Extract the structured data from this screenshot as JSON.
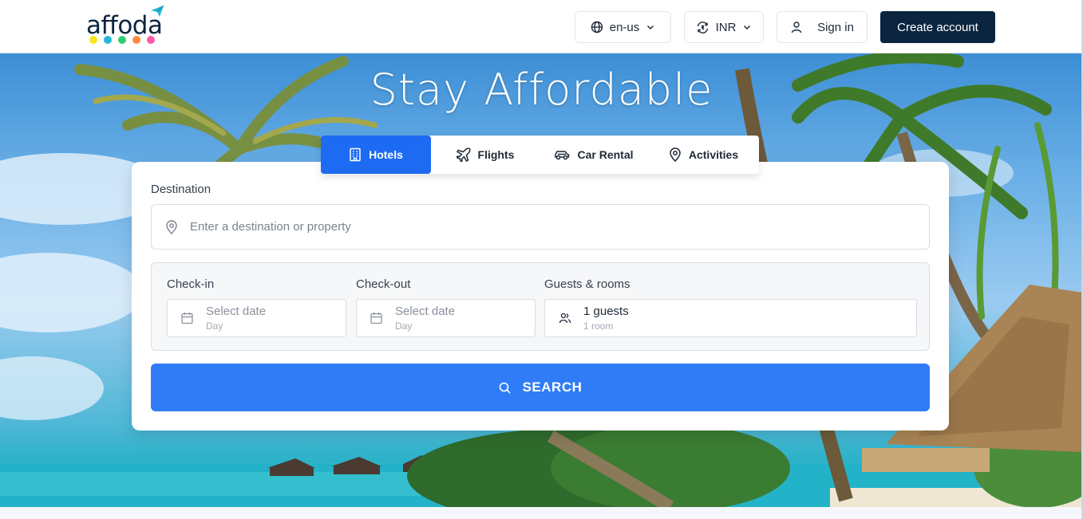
{
  "header": {
    "logo_text": "affoda",
    "logo_dot_colors": [
      "#f8e71c",
      "#22b8d6",
      "#2ecc71",
      "#ff8a3d",
      "#ff5aa5"
    ],
    "language_label": "en-us",
    "currency_label": "INR",
    "signin_label": "Sign in",
    "create_account_label": "Create account"
  },
  "hero": {
    "title": "Stay Affordable"
  },
  "tabs": [
    {
      "label": "Hotels",
      "icon": "building-icon",
      "active": true
    },
    {
      "label": "Flights",
      "icon": "airplane-icon",
      "active": false
    },
    {
      "label": "Car Rental",
      "icon": "car-icon",
      "active": false
    },
    {
      "label": "Activities",
      "icon": "location-pin-icon",
      "active": false
    }
  ],
  "search": {
    "destination_label": "Destination",
    "destination_placeholder": "Enter a destination or property",
    "checkin_label": "Check-in",
    "checkin_value": "Select date",
    "checkin_sub": "Day",
    "checkout_label": "Check-out",
    "checkout_value": "Select date",
    "checkout_sub": "Day",
    "guests_label": "Guests & rooms",
    "guests_value": "1 guests",
    "rooms_value": "1 room",
    "search_button_label": "SEARCH"
  },
  "colors": {
    "brand_dark": "#0b2540",
    "accent_blue": "#1d6bf3",
    "search_blue": "#2f7cf6"
  }
}
